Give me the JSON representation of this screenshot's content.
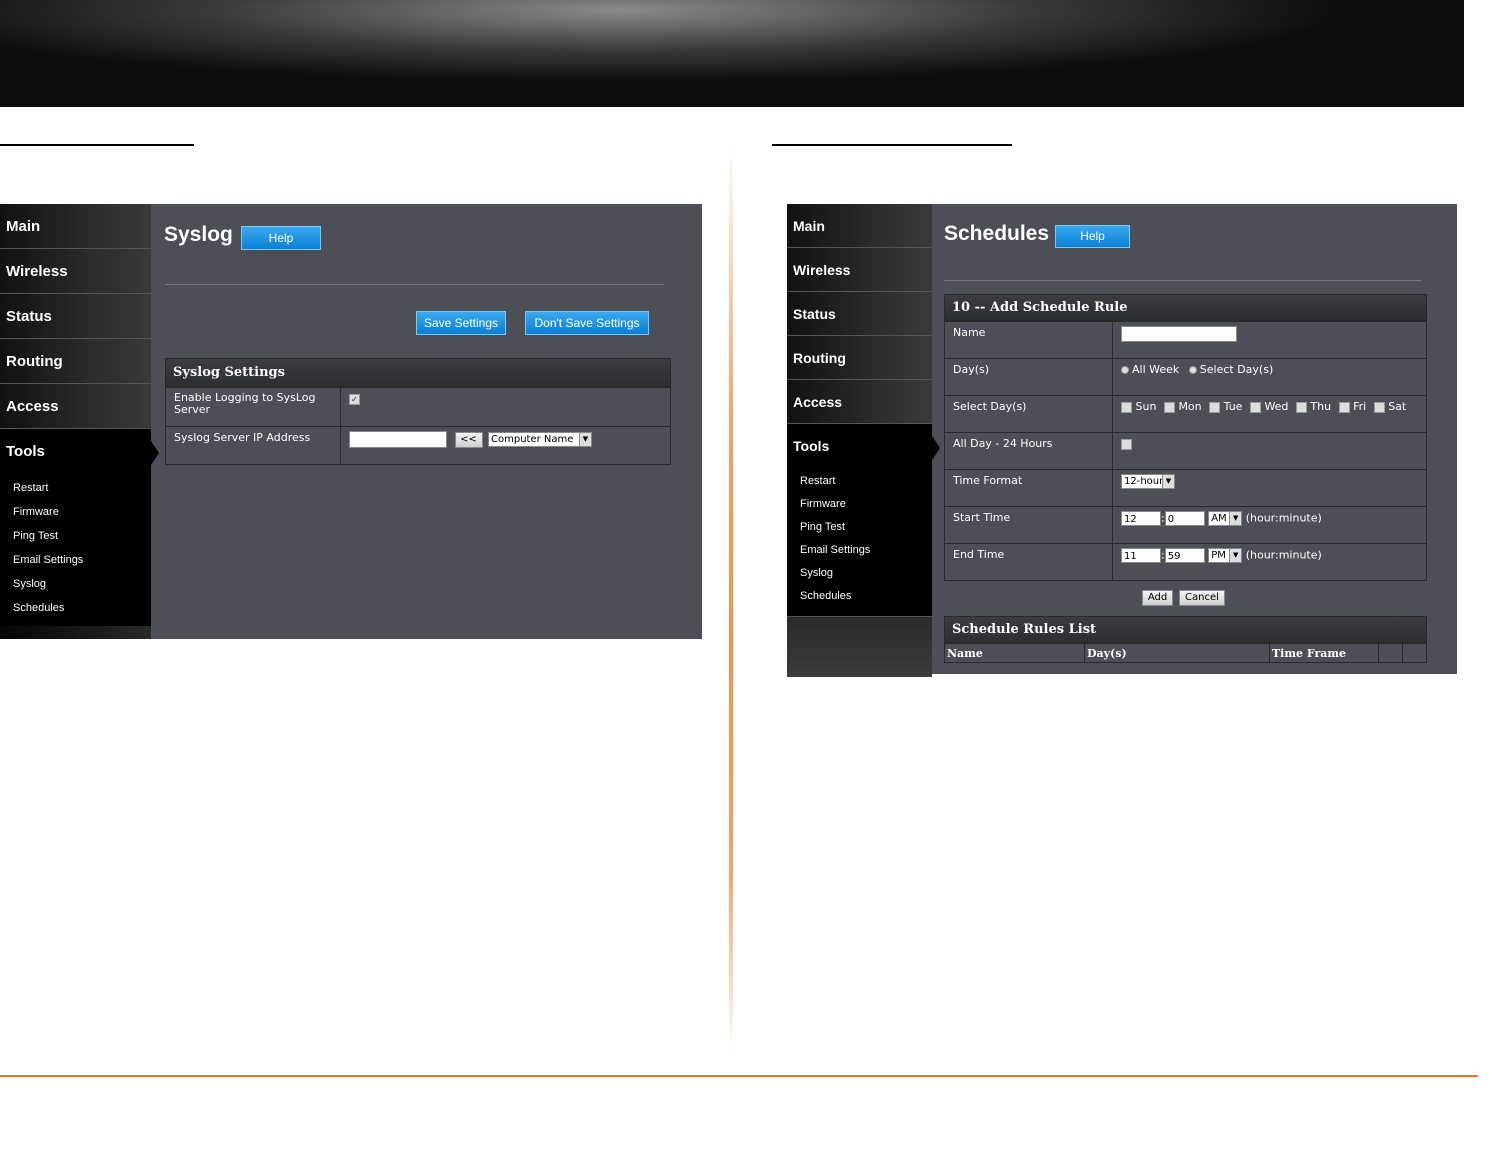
{
  "left": {
    "sidebar": {
      "items": [
        {
          "label": "Main"
        },
        {
          "label": "Wireless"
        },
        {
          "label": "Status"
        },
        {
          "label": "Routing"
        },
        {
          "label": "Access"
        },
        {
          "label": "Tools"
        }
      ],
      "sub_items": [
        {
          "label": "Restart"
        },
        {
          "label": "Firmware"
        },
        {
          "label": "Ping Test"
        },
        {
          "label": "Email Settings"
        },
        {
          "label": "Syslog"
        },
        {
          "label": "Schedules"
        }
      ]
    },
    "title": "Syslog",
    "help_label": "Help",
    "save_label": "Save Settings",
    "dont_save_label": "Don't Save Settings",
    "section_title": "Syslog Settings",
    "rows": [
      {
        "label": "Enable Logging to SysLog Server",
        "checked": true
      },
      {
        "label": "Syslog Server IP Address"
      }
    ],
    "ip_value": "",
    "copy_button": "<<",
    "computer_select": "Computer Name"
  },
  "right": {
    "sidebar": {
      "items": [
        {
          "label": "Main"
        },
        {
          "label": "Wireless"
        },
        {
          "label": "Status"
        },
        {
          "label": "Routing"
        },
        {
          "label": "Access"
        },
        {
          "label": "Tools"
        }
      ],
      "sub_items": [
        {
          "label": "Restart"
        },
        {
          "label": "Firmware"
        },
        {
          "label": "Ping Test"
        },
        {
          "label": "Email Settings"
        },
        {
          "label": "Syslog"
        },
        {
          "label": "Schedules"
        }
      ]
    },
    "title": "Schedules",
    "help_label": "Help",
    "section_title": "10 -- Add Schedule Rule",
    "rows": {
      "name": "Name",
      "days": "Day(s)",
      "select_days": "Select Day(s)",
      "all_day": "All Day - 24 Hours",
      "time_format": "Time Format",
      "start_time": "Start Time",
      "end_time": "End Time"
    },
    "name_value": "",
    "radio_all_week": "All Week",
    "radio_select_days": "Select Day(s)",
    "weekdays": [
      "Sun",
      "Mon",
      "Tue",
      "Wed",
      "Thu",
      "Fri",
      "Sat"
    ],
    "time_format_value": "12-hour",
    "start": {
      "hour": "12",
      "minute": "0",
      "ampm": "AM"
    },
    "end": {
      "hour": "11",
      "minute": "59",
      "ampm": "PM"
    },
    "hour_minute_hint": "(hour:minute)",
    "add_label": "Add",
    "cancel_label": "Cancel",
    "list_title": "Schedule Rules List",
    "list_columns": [
      "Name",
      "Day(s)",
      "Time Frame"
    ]
  }
}
